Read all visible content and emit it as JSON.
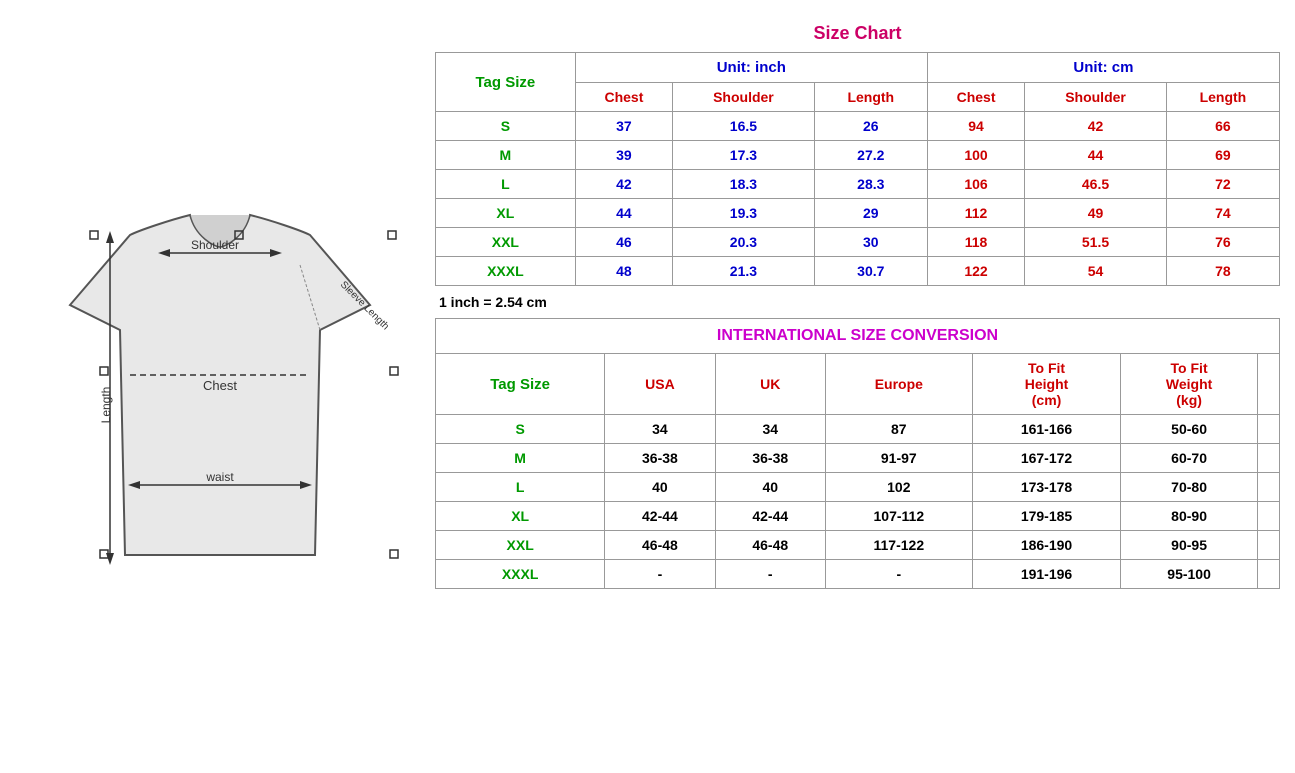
{
  "title": "Size Chart",
  "intl_title": "INTERNATIONAL SIZE CONVERSION",
  "conversion_note": "1 inch = 2.54 cm",
  "unit_inch": "Unit: inch",
  "unit_cm": "Unit: cm",
  "tag_size_label": "Tag Size",
  "size_headers_inch": [
    "Chest",
    "Shoulder",
    "Length"
  ],
  "size_headers_cm": [
    "Chest",
    "Shoulder",
    "Length"
  ],
  "size_rows": [
    {
      "tag": "S",
      "inch_chest": "37",
      "inch_shoulder": "16.5",
      "inch_length": "26",
      "cm_chest": "94",
      "cm_shoulder": "42",
      "cm_length": "66"
    },
    {
      "tag": "M",
      "inch_chest": "39",
      "inch_shoulder": "17.3",
      "inch_length": "27.2",
      "cm_chest": "100",
      "cm_shoulder": "44",
      "cm_length": "69"
    },
    {
      "tag": "L",
      "inch_chest": "42",
      "inch_shoulder": "18.3",
      "inch_length": "28.3",
      "cm_chest": "106",
      "cm_shoulder": "46.5",
      "cm_length": "72"
    },
    {
      "tag": "XL",
      "inch_chest": "44",
      "inch_shoulder": "19.3",
      "inch_length": "29",
      "cm_chest": "112",
      "cm_shoulder": "49",
      "cm_length": "74"
    },
    {
      "tag": "XXL",
      "inch_chest": "46",
      "inch_shoulder": "20.3",
      "inch_length": "30",
      "cm_chest": "118",
      "cm_shoulder": "51.5",
      "cm_length": "76"
    },
    {
      "tag": "XXXL",
      "inch_chest": "48",
      "inch_shoulder": "21.3",
      "inch_length": "30.7",
      "cm_chest": "122",
      "cm_shoulder": "54",
      "cm_length": "78"
    }
  ],
  "intl_headers": {
    "tag": "Tag Size",
    "usa": "USA",
    "uk": "UK",
    "europe": "Europe",
    "to_fit_height": "To Fit\nHeight\n(cm)",
    "to_fit_weight": "To Fit\nWeight\n(kg)"
  },
  "intl_rows": [
    {
      "tag": "S",
      "usa": "34",
      "uk": "34",
      "europe": "87",
      "height": "161-166",
      "weight": "50-60"
    },
    {
      "tag": "M",
      "usa": "36-38",
      "uk": "36-38",
      "europe": "91-97",
      "height": "167-172",
      "weight": "60-70"
    },
    {
      "tag": "L",
      "usa": "40",
      "uk": "40",
      "europe": "102",
      "height": "173-178",
      "weight": "70-80"
    },
    {
      "tag": "XL",
      "usa": "42-44",
      "uk": "42-44",
      "europe": "107-112",
      "height": "179-185",
      "weight": "80-90"
    },
    {
      "tag": "XXL",
      "usa": "46-48",
      "uk": "46-48",
      "europe": "117-122",
      "height": "186-190",
      "weight": "90-95"
    },
    {
      "tag": "XXXL",
      "usa": "-",
      "uk": "-",
      "europe": "-",
      "height": "191-196",
      "weight": "95-100"
    }
  ]
}
